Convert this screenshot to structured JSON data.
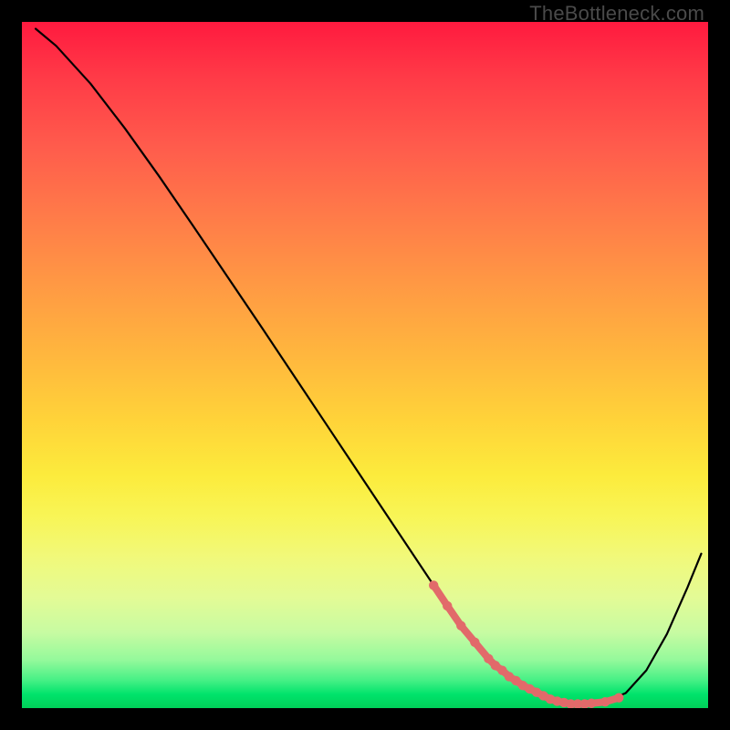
{
  "watermark": "TheBottleneck.com",
  "chart_data": {
    "type": "line",
    "title": "",
    "xlabel": "",
    "ylabel": "",
    "xlim": [
      0,
      100
    ],
    "ylim": [
      0,
      100
    ],
    "series": [
      {
        "name": "bottleneck-curve",
        "x": [
          2,
          5,
          10,
          15,
          20,
          25,
          30,
          35,
          40,
          45,
          50,
          55,
          60,
          62,
          64,
          67,
          70,
          73,
          76,
          78,
          80,
          82,
          85,
          88,
          91,
          94,
          97,
          99
        ],
        "y": [
          99,
          96.5,
          91,
          84.5,
          77.5,
          70.2,
          62.8,
          55.4,
          47.9,
          40.4,
          32.9,
          25.4,
          17.9,
          14.9,
          12,
          8.5,
          5.5,
          3.3,
          1.8,
          1.0,
          0.6,
          0.6,
          0.9,
          2.2,
          5.5,
          10.8,
          17.6,
          22.5
        ]
      },
      {
        "name": "highlight-segment",
        "x": [
          60,
          62,
          64,
          66,
          68,
          69,
          70,
          71,
          72,
          73,
          74,
          75,
          76,
          77,
          78,
          79,
          80,
          81,
          82,
          83,
          85,
          87
        ],
        "y": [
          17.9,
          14.9,
          12,
          9.6,
          7.2,
          6.2,
          5.5,
          4.6,
          4.0,
          3.3,
          2.8,
          2.3,
          1.8,
          1.3,
          1.0,
          0.8,
          0.6,
          0.6,
          0.6,
          0.7,
          0.9,
          1.5
        ]
      }
    ],
    "colors": {
      "curve_stroke": "#000000",
      "highlight_stroke": "#e26a6a",
      "highlight_dot_fill": "#e26a6a"
    }
  }
}
